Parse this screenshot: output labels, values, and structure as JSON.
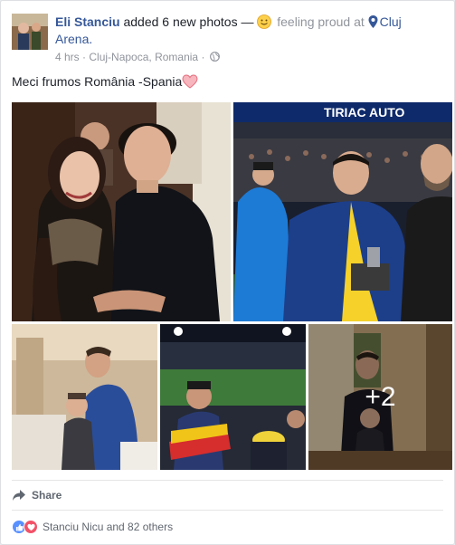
{
  "post": {
    "author": "Eli Stanciu",
    "action": "added 6 new photos —",
    "feeling": "feeling proud at",
    "place_line1": "Cluj",
    "place_line2": "Arena.",
    "time": "4 hrs",
    "dot": "·",
    "location": "Cluj-Napoca, Romania",
    "text": "Meci frumos România -Spania"
  },
  "photos": {
    "p1_banner": "TIRIAC AUTO",
    "more_count": "+2"
  },
  "actions": {
    "share_label": "Share"
  },
  "reactions": {
    "summary": "Stanciu Nicu and 82 others"
  },
  "colors": {
    "link": "#365899",
    "muted": "#90949c",
    "like": "#5890ff",
    "love": "#f25268"
  },
  "icons": [
    "feeling-emoji-icon",
    "location-pin-icon",
    "globe-icon",
    "heart-emoji-icon",
    "share-arrow-icon",
    "like-reaction-icon",
    "love-reaction-icon"
  ]
}
